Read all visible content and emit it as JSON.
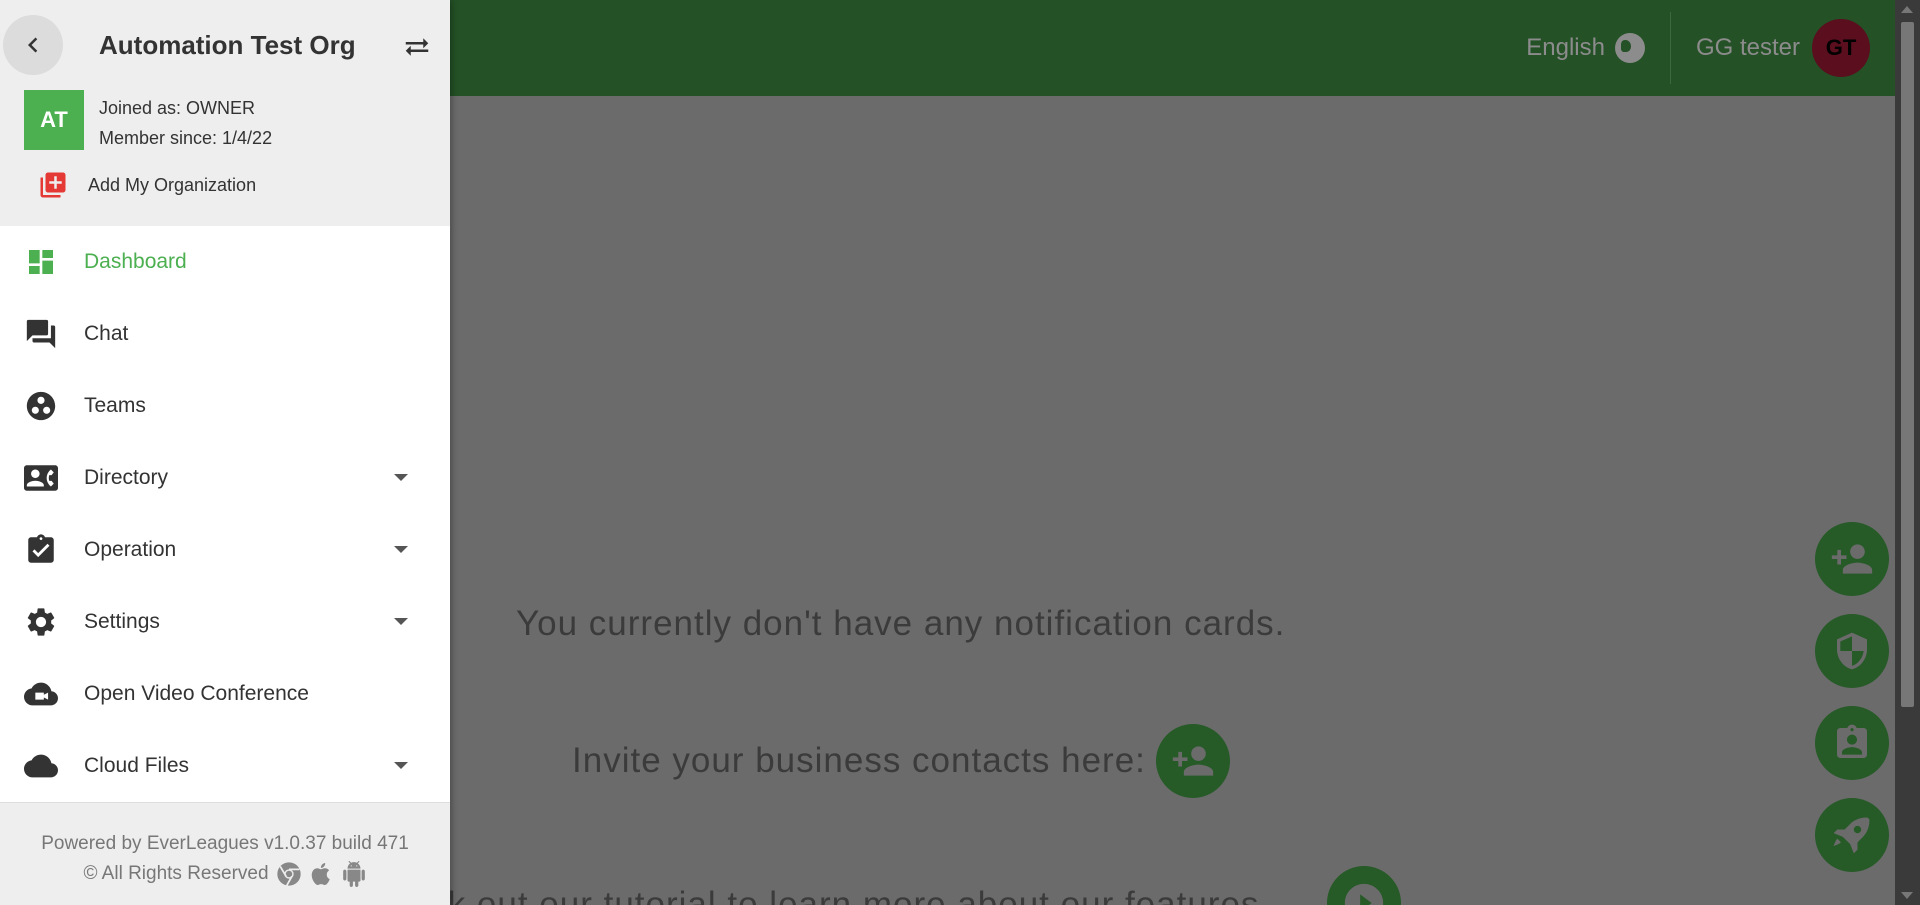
{
  "org": {
    "name": "Automation Test Org",
    "initials": "AT",
    "joined_as": "Joined as: OWNER",
    "member_since": "Member since: 1/4/22",
    "add_org_label": "Add My Organization"
  },
  "nav": {
    "dashboard": "Dashboard",
    "chat": "Chat",
    "teams": "Teams",
    "directory": "Directory",
    "operation": "Operation",
    "settings": "Settings",
    "video": "Open Video Conference",
    "cloud": "Cloud Files"
  },
  "footer": {
    "powered": "Powered by EverLeagues v1.0.37 build 471",
    "rights": "© All Rights Reserved"
  },
  "topbar": {
    "language": "English",
    "user_name": "GG tester",
    "user_initials": "GT"
  },
  "main": {
    "empty_message": "You currently don't have any notification cards.",
    "invite_text": "Invite your business contacts here:",
    "tutorial_text": "Check out our tutorial to learn more about our features:"
  },
  "colors": {
    "brand_green": "#245126",
    "active_green": "#4caf50",
    "add_org_red": "#e53935"
  },
  "icons": [
    "back-arrow-icon",
    "switch-org-icon",
    "add-org-icon",
    "dashboard-icon",
    "chat-icon",
    "teams-icon",
    "directory-icon",
    "operation-icon",
    "settings-icon",
    "video-icon",
    "cloud-icon",
    "chrome-icon",
    "apple-icon",
    "android-icon",
    "globe-icon",
    "add-person-icon",
    "shield-icon",
    "badge-icon",
    "rocket-icon",
    "play-icon"
  ]
}
